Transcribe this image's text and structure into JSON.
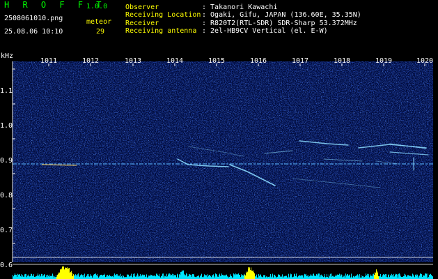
{
  "header": {
    "app_name": "H R O F F T",
    "app_version": "1.0.0",
    "file_name": "2508061010.png",
    "datetime": "25.08.06 10:10",
    "meteor_label": "meteor",
    "meteor_count": "29"
  },
  "info": {
    "observer_label": "Observer",
    "observer_value": ": Takanori Kawachi",
    "location_label": "Receiving Location",
    "location_value": ": Ogaki, Gifu, JAPAN (136.60E, 35.35N)",
    "receiver_label": "Receiver",
    "receiver_value": ": R820T2(RTL-SDR) SDR-Sharp 53.372MHz",
    "antenna_label": "Receiving antenna",
    "antenna_value": ": 2el-HB9CV Vertical (el. E-W)"
  },
  "axes": {
    "unit": "kHz",
    "x_ticks": [
      "1011",
      "1012",
      "1013",
      "1014",
      "1015",
      "1016",
      "1017",
      "1018",
      "1019",
      "1020"
    ],
    "y_ticks": [
      "1.1",
      "1.0",
      "0.9",
      "0.8",
      "0.7",
      "0.6"
    ]
  },
  "colors": {
    "background": "#000000",
    "noise_dark": "#000a40",
    "noise_light": "#1a3cc8",
    "signal": "#8cdcff",
    "carrier": "#5ab4ff",
    "histogram": "#00e5ff",
    "histogram_peak": "#ffff00"
  }
}
